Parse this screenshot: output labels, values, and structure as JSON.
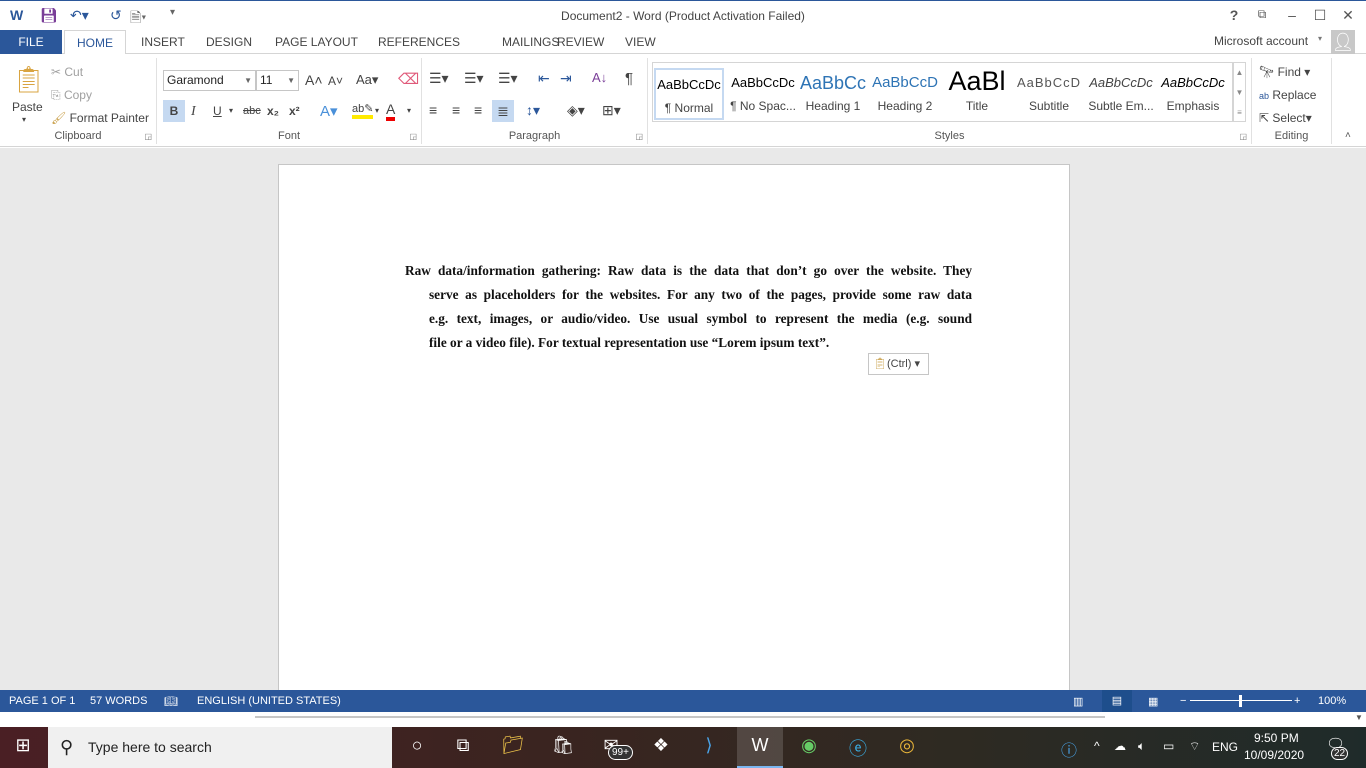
{
  "window": {
    "title": "Document2 - Word (Product Activation Failed)",
    "help": "?",
    "account": "Microsoft account"
  },
  "tabs": [
    "FILE",
    "HOME",
    "INSERT",
    "DESIGN",
    "PAGE LAYOUT",
    "REFERENCES",
    "MAILINGS",
    "REVIEW",
    "VIEW"
  ],
  "clipboard": {
    "paste": "Paste",
    "cut": "Cut",
    "copy": "Copy",
    "format_painter": "Format Painter",
    "label": "Clipboard"
  },
  "font": {
    "name": "Garamond",
    "size": "11",
    "label": "Font",
    "change_case": "Aa",
    "bold": "B",
    "italic": "I",
    "underline": "U",
    "strike": "abc",
    "sub": "x₂",
    "sup": "x²"
  },
  "paragraph": {
    "label": "Paragraph",
    "pilcrow": "¶"
  },
  "styles": {
    "label": "Styles",
    "items": [
      {
        "preview": "AaBbCcDc",
        "name": "¶ Normal"
      },
      {
        "preview": "AaBbCcDc",
        "name": "¶ No Spac..."
      },
      {
        "preview": "AaBbCc",
        "name": "Heading 1"
      },
      {
        "preview": "AaBbCcD",
        "name": "Heading 2"
      },
      {
        "preview": "AaBl",
        "name": "Title"
      },
      {
        "preview": "AaBbCcD",
        "name": "Subtitle"
      },
      {
        "preview": "AaBbCcDc",
        "name": "Subtle Em..."
      },
      {
        "preview": "AaBbCcDc",
        "name": "Emphasis"
      }
    ]
  },
  "editing": {
    "find": "Find",
    "replace": "Replace",
    "select": "Select",
    "label": "Editing"
  },
  "document": {
    "lines": [
      "Raw data/information gathering: Raw data is the data that don’t go over the website. They",
      "serve as placeholders for the websites. For any two of the pages, provide some raw data",
      "e.g. text, images, or audio/video. Use usual symbol to represent the media (e.g. sound",
      "file or a video file). For textual representation use “Lorem ipsum text”."
    ],
    "paste_options": "(Ctrl)"
  },
  "status": {
    "page": "PAGE 1 OF 1",
    "words": "57 WORDS",
    "language": "ENGLISH (UNITED STATES)",
    "zoom": "100%",
    "zoom_percent": 100
  },
  "taskbar": {
    "search_placeholder": "Type here to search",
    "mail_badge": "99+",
    "lang": "ENG",
    "time": "9:50 PM",
    "date": "10/09/2020",
    "notifications": "22"
  },
  "colors": {
    "accent": "#2b579a"
  }
}
